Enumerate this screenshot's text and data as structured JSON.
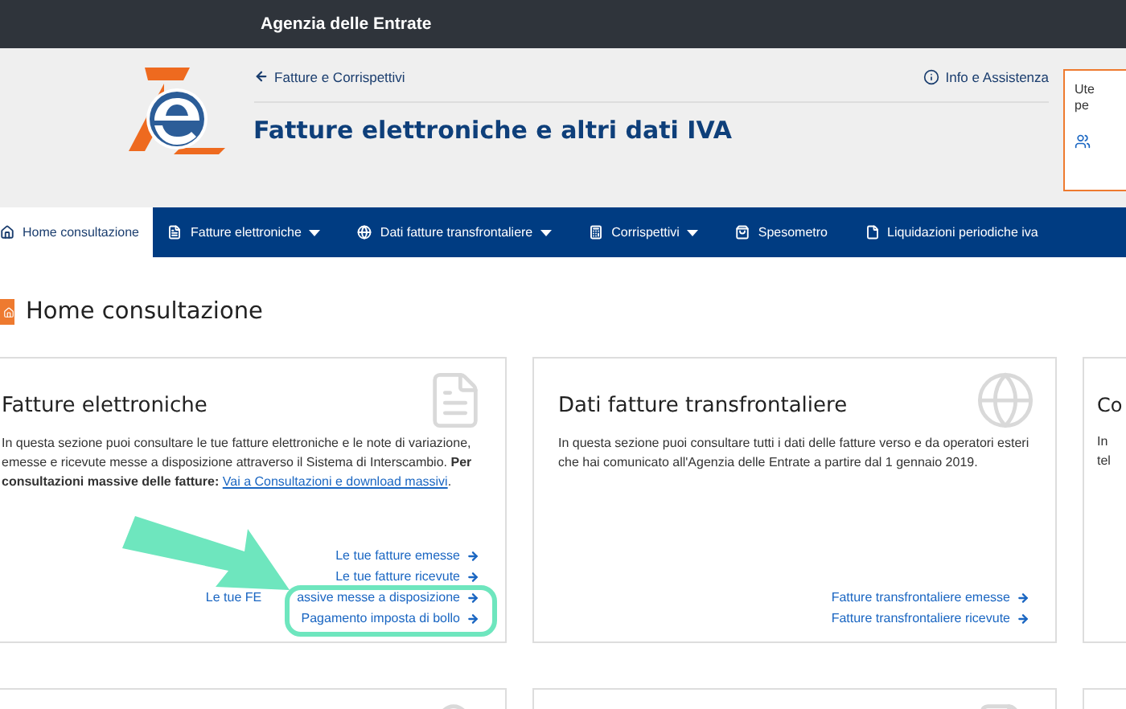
{
  "topbar": {
    "title": "Agenzia delle Entrate"
  },
  "header": {
    "back_link": "Fatture e Corrispettivi",
    "help_link": "Info e Assistenza",
    "title": "Fatture elettroniche e altri dati IVA",
    "user_box": {
      "lines": [
        "Ute",
        "pe"
      ]
    }
  },
  "nav": [
    {
      "label": "Home consultazione",
      "selected": true,
      "dropdown": false
    },
    {
      "label": "Fatture elettroniche",
      "selected": false,
      "dropdown": true
    },
    {
      "label": "Dati fatture transfrontaliere",
      "selected": false,
      "dropdown": true
    },
    {
      "label": "Corrispettivi",
      "selected": false,
      "dropdown": true
    },
    {
      "label": "Spesometro",
      "selected": false,
      "dropdown": false
    },
    {
      "label": "Liquidazioni periodiche iva",
      "selected": false,
      "dropdown": false
    }
  ],
  "page_title": "Home consultazione",
  "cards": [
    {
      "kind": "full",
      "title": "Fatture elettroniche",
      "body": "In questa sezione puoi consultare le tue fatture elettroniche e le note di variazione, emesse e ricevute messe a disposizione attraverso il Sistema di Interscambio. **Per consultazioni massive delle fatture:**",
      "body_link": "Vai a Consultazioni e download massivi",
      "body_end": ".",
      "links": [
        {
          "parts": [
            "Le tue fatture emesse"
          ]
        },
        {
          "parts": [
            "Le tue fatture ricevute"
          ]
        },
        {
          "parts": [
            "Le tue FE",
            "assive messe a disposizione"
          ]
        },
        {
          "parts": [
            "Pagamento imposta di bollo"
          ]
        }
      ]
    },
    {
      "kind": "full",
      "title": "Dati fatture transfrontaliere",
      "body": "In questa sezione puoi consultare tutti i dati delle fatture verso e da operatori esteri che hai comunicato all'Agenzia delle Entrate a partire dal 1 gennaio 2019.",
      "links": [
        {
          "parts": [
            "Fatture transfrontaliere emesse"
          ]
        },
        {
          "parts": [
            "Fatture transfrontaliere ricevute"
          ]
        }
      ]
    },
    {
      "kind": "cut",
      "title": "Co",
      "body_lines": [
        "In",
        "tel"
      ]
    }
  ]
}
